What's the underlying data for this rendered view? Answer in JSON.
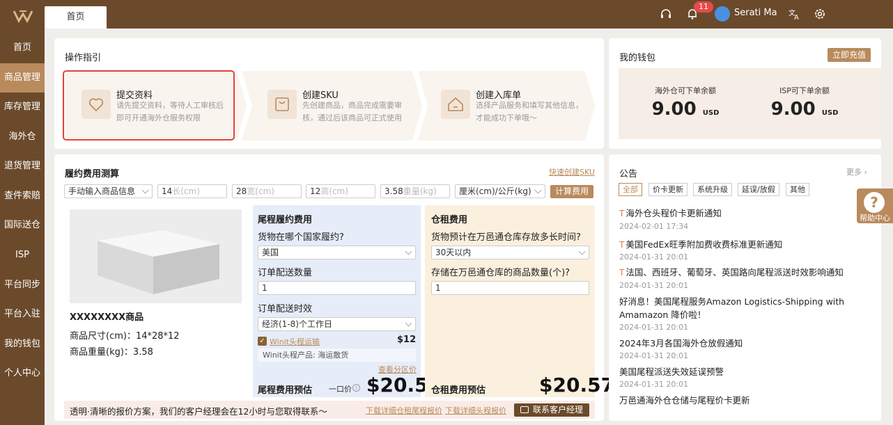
{
  "sidebar": {
    "items": [
      {
        "label": "首页"
      },
      {
        "label": "商品管理"
      },
      {
        "label": "库存管理"
      },
      {
        "label": "海外仓"
      },
      {
        "label": "退货管理"
      },
      {
        "label": "查件索赔"
      },
      {
        "label": "国际送仓"
      },
      {
        "label": "ISP"
      },
      {
        "label": "平台同步"
      },
      {
        "label": "平台入驻"
      },
      {
        "label": "我的钱包"
      },
      {
        "label": "个人中心"
      }
    ],
    "active_index": 1
  },
  "topbar": {
    "tab_home": "首页",
    "notification_count": "11",
    "user_name": "Serati Ma"
  },
  "guide": {
    "title": "操作指引",
    "steps": [
      {
        "title": "提交资料",
        "desc1": "请先提交资料，等待人工审核后",
        "desc2": "即可开通海外仓服务权限"
      },
      {
        "title": "创建SKU",
        "desc1": "先创建商品，商品完成需要审",
        "desc2": "核，通过后该商品可正式使用"
      },
      {
        "title": "创建入库单",
        "desc1": "选择产品服务和填写其他信息，",
        "desc2": "才能成功下单哦～"
      }
    ]
  },
  "wallet": {
    "title": "我的钱包",
    "recharge": "立即充值",
    "overseas_label": "海外仓可下单余额",
    "overseas_value": "9.00",
    "overseas_unit": "USD",
    "isp_label": "ISP可下单余额",
    "isp_value": "9.00",
    "isp_unit": "USD"
  },
  "calc": {
    "title": "履约费用测算",
    "quick_sku": "快速创建SKU",
    "mode": "手动输入商品信息",
    "length": "14",
    "length_ph": "长(cm)",
    "width": "28",
    "width_ph": "宽(cm)",
    "height": "12",
    "height_ph": "高(cm)",
    "weight": "3.58",
    "weight_ph": "重量(kg)",
    "unit": "厘米(cm)/公斤(kg)",
    "calc_button": "计算费用",
    "product_name": "XXXXXXXX商品",
    "size_text": "商品尺寸(cm)：14*28*12",
    "weight_text": "商品重量(kg)：3.58",
    "tail": {
      "title": "尾程履约费用",
      "q_country": "货物在哪个国家履约?",
      "country": "美国",
      "q_qty": "订单配送数量",
      "qty": "1",
      "q_time": "订单配送时效",
      "time": "经济(1-8)个工作日",
      "winit_link": "Winit头程运输",
      "winit_price": "$12",
      "winit_product": "Winit头程产品: 海运散货",
      "zone_price": "查看分区价",
      "estimate_label": "尾程费用预估",
      "one_price": "一口价",
      "estimate_value": "$20.57"
    },
    "storage": {
      "title": "仓租费用",
      "q_days": "货物预计在万邑通仓库存放多长时间?",
      "days": "30天以内",
      "q_count": "存储在万邑通仓库的商品数量(个)?",
      "count": "1",
      "estimate_label": "仓租费用预估",
      "estimate_value": "$20.57"
    },
    "footer": {
      "text": "透明·清晰的报价方案，我们的客户经理会在12小时与您取得联系～",
      "link1": "下载详细仓租尾程报价",
      "link2": "下载详细头程报价",
      "contact": "联系客户经理"
    }
  },
  "announce": {
    "title": "公告",
    "more": "更多",
    "tags": [
      "全部",
      "价卡更新",
      "系统升级",
      "延误/放假",
      "其他"
    ],
    "items": [
      {
        "title": "海外仓头程价卡更新通知",
        "date": "2024-02-01 17:34",
        "tagged": true
      },
      {
        "title": "美国FedEx旺季附加费收费标准更新通知",
        "date": "2024-01-31 20:01",
        "tagged": true
      },
      {
        "title": "法国、西班牙、葡萄牙、英国路向尾程派送时效影响通知",
        "date": "2024-01-31 20:01",
        "tagged": true
      },
      {
        "title": "好消息！美国尾程服务Amazon Logistics-Shipping with Amamazon 降价啦！",
        "date": "2024-01-31 20:01",
        "tagged": false
      },
      {
        "title": "2024年3月各国海外仓放假通知",
        "date": "2024-01-31 20:01",
        "tagged": false
      },
      {
        "title": "美国尾程派送失效延误预警",
        "date": "2024-01-31 20:01",
        "tagged": false
      },
      {
        "title": "万邑通海外仓仓储与尾程价卡更新",
        "date": "",
        "tagged": false
      }
    ]
  },
  "help": {
    "label": "帮助中心"
  }
}
